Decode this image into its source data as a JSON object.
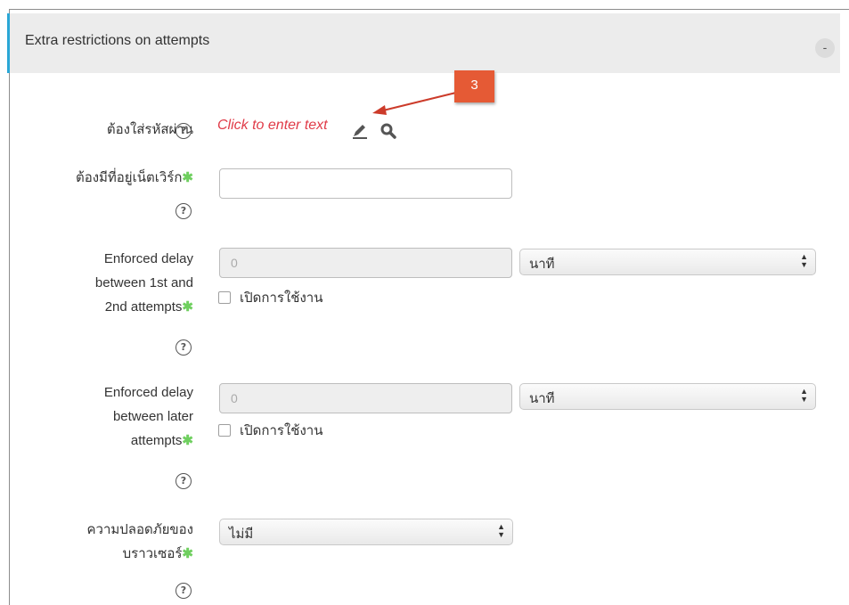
{
  "section": {
    "title": "Extra restrictions on attempts",
    "collapse_label": "-"
  },
  "help_glyph": "?",
  "required_marker": "✱",
  "password": {
    "label": "ต้องใส่รหัสผ่าน",
    "click_text": "Click to enter text",
    "edit_icon": "pencil-icon",
    "reveal_icon": "search-icon"
  },
  "network": {
    "label": "ต้องมีที่อยู่เน็ตเวิร์ก",
    "value": ""
  },
  "delay1": {
    "label_lines": [
      "Enforced delay",
      "between 1st and",
      "2nd attempts"
    ],
    "value": "0",
    "unit": "นาที",
    "enable_label": "เปิดการใช้งาน"
  },
  "delay2": {
    "label_lines": [
      "Enforced delay",
      "between later",
      "attempts"
    ],
    "value": "0",
    "unit": "นาที",
    "enable_label": "เปิดการใช้งาน"
  },
  "browser_security": {
    "label_lines": [
      "ความปลอดภัยของ",
      "บราวเซอร์"
    ],
    "value": "ไม่มี"
  },
  "annotation": {
    "badge": "3",
    "color": "#e55a35"
  }
}
